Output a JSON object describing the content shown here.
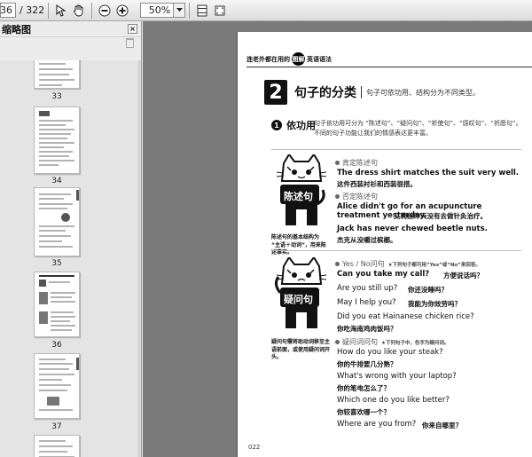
{
  "toolbar": {
    "page_current": "36",
    "page_total": "/ 322",
    "zoom": "50%"
  },
  "sidebar": {
    "title": "缩略图",
    "close": "×",
    "thumbnails": [
      {
        "number": "33"
      },
      {
        "number": "34"
      },
      {
        "number": "35"
      },
      {
        "number": "36"
      },
      {
        "number": "37"
      }
    ]
  },
  "page": {
    "header": {
      "before": "连老外都在用的",
      "circle": "图解",
      "after": "英语语法"
    },
    "section": {
      "number": "2",
      "title": "句子的分类",
      "subtitle": "句子可依功用、结构分为不同类型。"
    },
    "subsection": {
      "number": "1",
      "title": "依功用",
      "desc": "句子依功用可分为 “陈述句”、“疑问句”、“祈使句”、“感叹句”、“祈愿句”。不同的句子功能让我们的情感表达更丰富。"
    },
    "declarative": {
      "cat_tag": "陈述句",
      "cat_desc": "陈述句的基本结构为 “主语＋动词”，用来陈述事实。",
      "affirmative_label": "肯定陈述句",
      "affirmative": [
        {
          "en": "The dress shirt matches the suit very well.",
          "zh": "这件西装衬衫和西装很搭。"
        }
      ],
      "negative_label": "否定陈述句",
      "negative": [
        {
          "en": "Alice didn't go for an acupuncture treatment yesterday.",
          "zh": "艾莉丝昨天没有去做针灸治疗。"
        },
        {
          "en": "Jack has never chewed beetle nuts.",
          "zh": "杰克从没嚼过槟榔。"
        }
      ]
    },
    "interrogative": {
      "cat_tag": "疑问句",
      "cat_desc": "疑问句需将助动词移至主语前面，或使用疑问词开头。",
      "yesno_label": "Yes / No问句",
      "yesno_note": "★下列句子都可用“Yes”或“No”来回答。",
      "yesno": [
        {
          "en": "Can you take my call?",
          "zh": "方便说话吗？"
        },
        {
          "en": "Are you still up?",
          "zh": "你还没睡吗？"
        },
        {
          "en": "May I help you?",
          "zh": "我能为你效劳吗？"
        },
        {
          "en": "Did you eat Hainanese chicken rice?",
          "zh": "你吃海南鸡肉饭吗？"
        }
      ],
      "wh_label": "疑问词问句",
      "wh_note": "★下列句子中，色字为疑问词。",
      "wh": [
        {
          "en": "How do you like your steak?",
          "zh": "你的牛排要几分熟？"
        },
        {
          "en": "What's wrong with your laptop?",
          "zh": "你的笔电怎么了？"
        },
        {
          "en": "Which one do you like better?",
          "zh": "你较喜欢哪一个？"
        },
        {
          "en": "Where are you from?",
          "zh": "你来自哪里？"
        }
      ]
    },
    "page_number": "022"
  }
}
